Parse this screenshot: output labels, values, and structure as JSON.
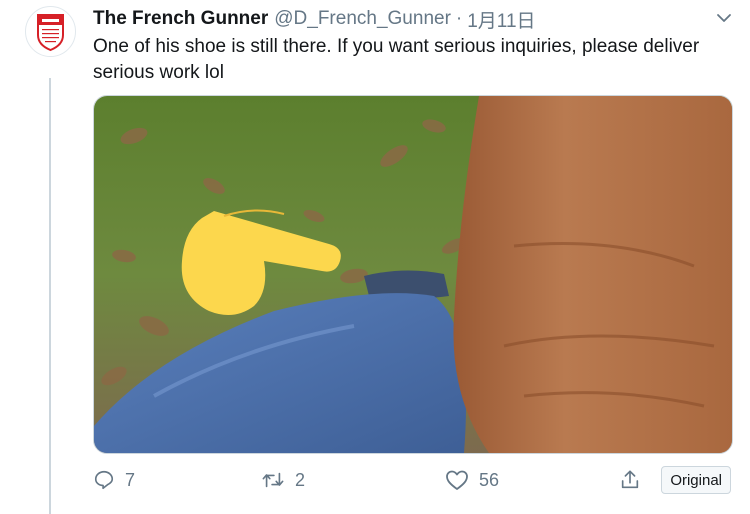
{
  "tweet": {
    "display_name": "The French Gunner",
    "handle": "@D_French_Gunner",
    "separator": "·",
    "date": "1月11日",
    "text": "One of his shoe is still there. If you want serious inquiries, please deliver serious work lol"
  },
  "icons": {
    "reply": "reply-icon",
    "retweet": "retweet-icon",
    "like": "heart-icon",
    "share": "share-icon",
    "more": "chevron-down-icon",
    "media_overlay": "pointing-hand-emoji"
  },
  "actions": {
    "reply_count": "7",
    "retweet_count": "2",
    "like_count": "56",
    "original_label": "Original"
  },
  "colors": {
    "brand_red": "#d62027",
    "muted": "#657786",
    "emoji_yellow": "#fcd74d",
    "sweater": "#b06e44",
    "jeans": "#4d74b3",
    "grass": "#6b8a3a"
  }
}
